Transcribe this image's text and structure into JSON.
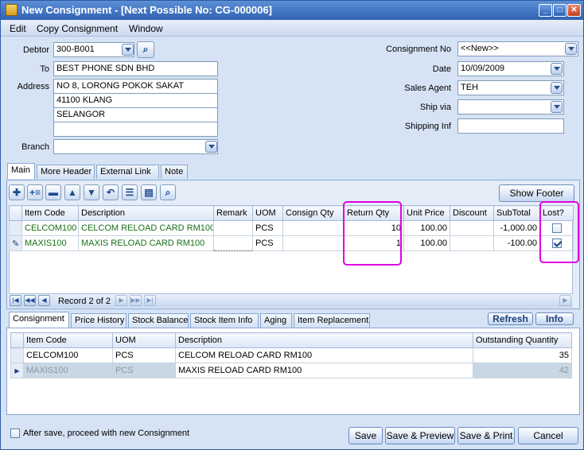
{
  "window": {
    "title": "New Consignment - [Next Possible No: CG-000006]"
  },
  "menu": [
    "Edit",
    "Copy Consignment",
    "Window"
  ],
  "header": {
    "debtor_label": "Debtor",
    "debtor": "300-B001",
    "to_label": "To",
    "to": "BEST PHONE SDN BHD",
    "address_label": "Address",
    "address": [
      "NO 8, LORONG POKOK SAKAT",
      "41100 KLANG",
      "SELANGOR",
      ""
    ],
    "branch_label": "Branch",
    "branch": "",
    "consignment_no_label": "Consignment No",
    "consignment_no": "<<New>>",
    "date_label": "Date",
    "date": "10/09/2009",
    "sales_agent_label": "Sales Agent",
    "sales_agent": "TEH",
    "ship_via_label": "Ship via",
    "ship_via": "",
    "shipping_inf_label": "Shipping Inf",
    "shipping_inf": ""
  },
  "tabs": [
    "Main",
    "More Header",
    "External Link",
    "Note"
  ],
  "toolbar": {
    "show_footer": "Show Footer"
  },
  "detail": {
    "columns": [
      "Item Code",
      "Description",
      "Remark",
      "UOM",
      "Consign Qty",
      "Return Qty",
      "Unit Price",
      "Discount",
      "SubTotal",
      "Lost?"
    ],
    "rows": [
      {
        "item_code": "CELCOM100",
        "description": "CELCOM RELOAD CARD RM100",
        "remark": "",
        "uom": "PCS",
        "consign_qty": "",
        "return_qty": "10",
        "unit_price": "100.00",
        "discount": "",
        "subtotal": "-1,000.00",
        "lost": false
      },
      {
        "item_code": "MAXIS100",
        "description": "MAXIS RELOAD CARD RM100",
        "remark": "",
        "uom": "PCS",
        "consign_qty": "",
        "return_qty": "1",
        "unit_price": "100.00",
        "discount": "",
        "subtotal": "-100.00",
        "lost": true
      }
    ],
    "record_text": "Record 2 of 2"
  },
  "bottom_tabs": [
    "Consignment",
    "Price History",
    "Stock Balance",
    "Stock Item Info",
    "Aging",
    "Item Replacement"
  ],
  "bottom_buttons": {
    "refresh": "Refresh",
    "info": "Info"
  },
  "outstanding": {
    "columns": [
      "Item Code",
      "UOM",
      "Description",
      "Outstanding Quantity"
    ],
    "rows": [
      {
        "item_code": "CELCOM100",
        "uom": "PCS",
        "description": "CELCOM RELOAD CARD RM100",
        "qty": "35"
      },
      {
        "item_code": "MAXIS100",
        "uom": "PCS",
        "description": "MAXIS RELOAD CARD RM100",
        "qty": "42"
      }
    ]
  },
  "footer": {
    "after_save_label": "After save, proceed with new Consignment",
    "save": "Save",
    "save_preview": "Save & Preview",
    "save_print": "Save & Print",
    "cancel": "Cancel"
  },
  "colors": {
    "highlight": "#e000e0",
    "title_blue": "#2f62b3",
    "item_green": "#1a6e1a"
  }
}
